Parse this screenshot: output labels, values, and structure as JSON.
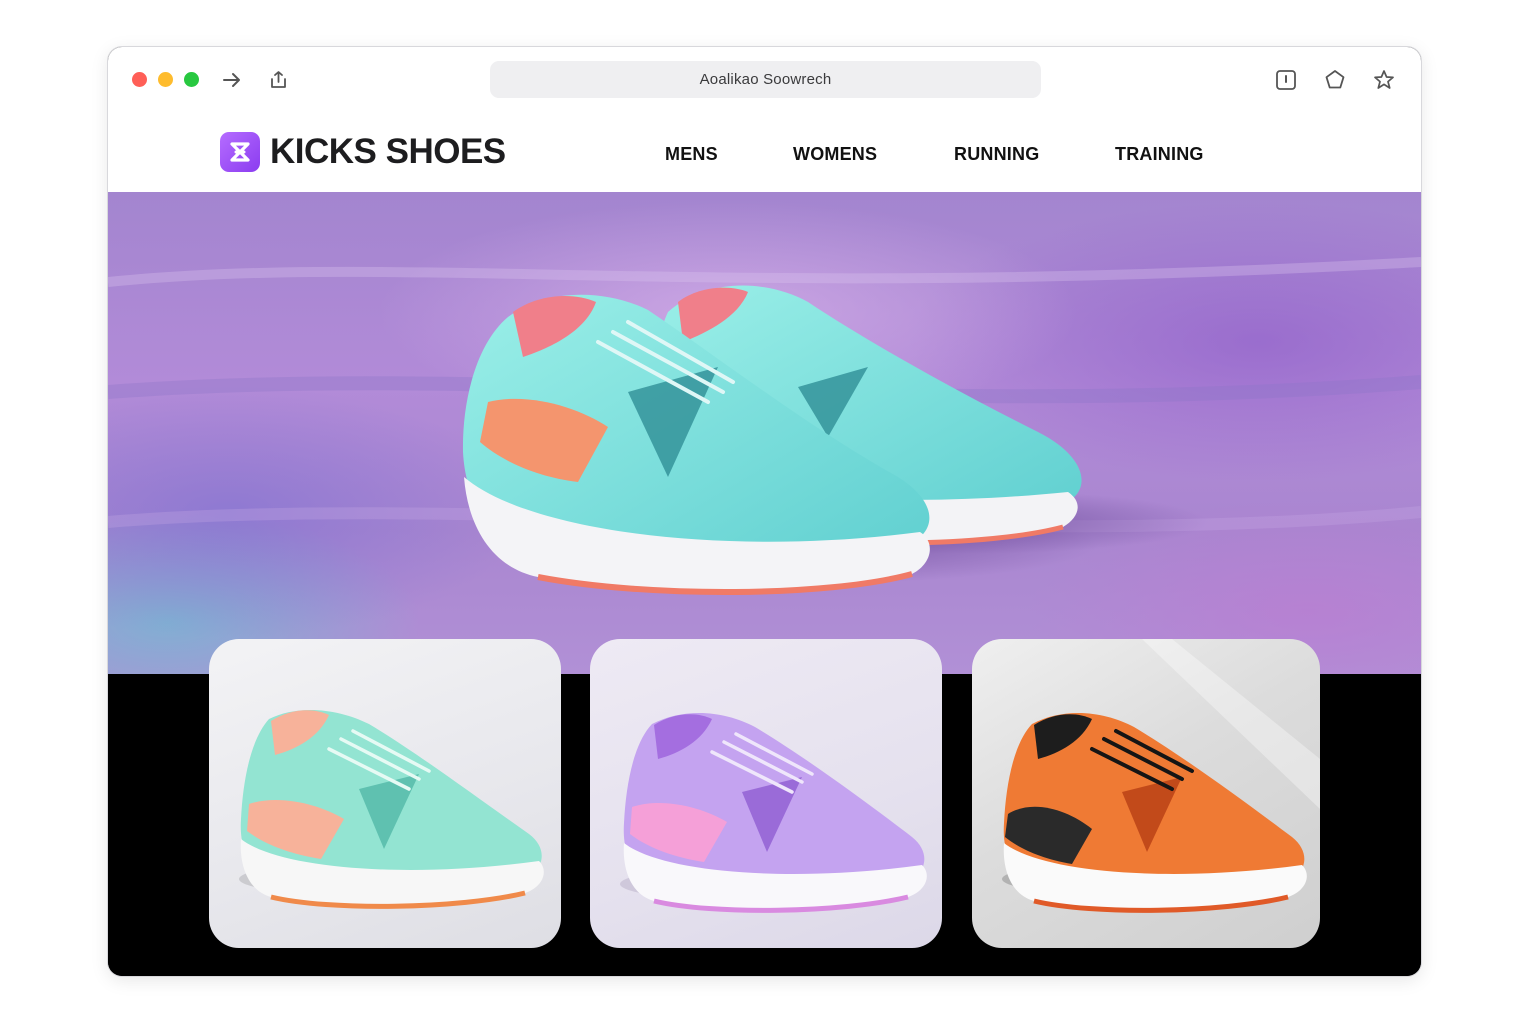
{
  "browser": {
    "address_text": "Aoalikao Soowrech",
    "icons": [
      "close-dot",
      "minimize-dot",
      "zoom-dot",
      "forward-arrow-icon",
      "share-icon",
      "info-icon",
      "extensions-icon",
      "star-icon"
    ]
  },
  "site": {
    "brand": "KICKS SHOES",
    "brand_color": "#9b4df5",
    "nav": [
      {
        "label": "MENS"
      },
      {
        "label": "WOMENS"
      },
      {
        "label": "RUNNING"
      },
      {
        "label": "TRAINING"
      }
    ]
  },
  "hero": {
    "product": "turquoise running shoes pair",
    "colors": {
      "upper": "#7fe0dc",
      "accent": "#f4866c",
      "sole": "#f5f5f7"
    }
  },
  "products": [
    {
      "colorway": "mint",
      "upper": "#8fe3d0",
      "accent": "#f7b49a"
    },
    {
      "colorway": "lavender",
      "upper": "#c3a1f0",
      "accent": "#f29ad8"
    },
    {
      "colorway": "orange",
      "upper": "#f07a35",
      "accent": "#1c1c1c"
    }
  ]
}
